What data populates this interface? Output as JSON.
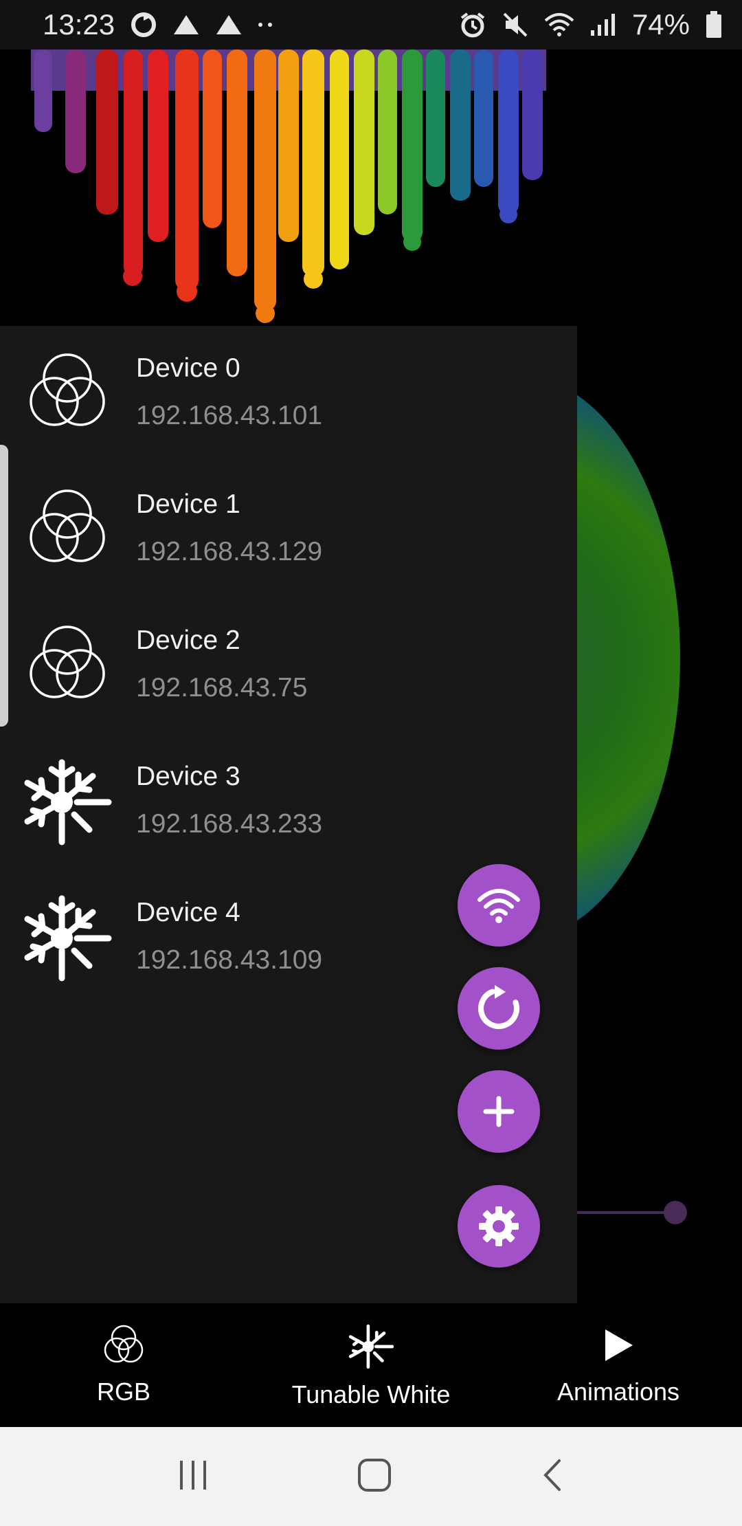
{
  "status_bar": {
    "time": "13:23",
    "battery_percent": "74%"
  },
  "devices": [
    {
      "name": "Device 0",
      "ip": "192.168.43.101",
      "type": "rgb-icon"
    },
    {
      "name": "Device 1",
      "ip": "192.168.43.129",
      "type": "rgb-icon"
    },
    {
      "name": "Device 2",
      "ip": "192.168.43.75",
      "type": "rgb-icon"
    },
    {
      "name": "Device 3",
      "ip": "192.168.43.233",
      "type": "tunable-white-icon"
    },
    {
      "name": "Device 4",
      "ip": "192.168.43.109",
      "type": "tunable-white-icon"
    }
  ],
  "fabs": [
    {
      "icon": "wifi-icon"
    },
    {
      "icon": "refresh-icon"
    },
    {
      "icon": "plus-icon"
    },
    {
      "icon": "gear-icon"
    }
  ],
  "bottom_nav": {
    "items": [
      {
        "label": "RGB",
        "icon": "rgb-icon"
      },
      {
        "label": "Tunable White",
        "icon": "tunable-white-icon"
      },
      {
        "label": "Animations",
        "icon": "play-icon"
      }
    ]
  },
  "colors": {
    "accent": "#a351c9",
    "drawer_bg": "#181818",
    "secondary_text": "#8f8f8f"
  }
}
